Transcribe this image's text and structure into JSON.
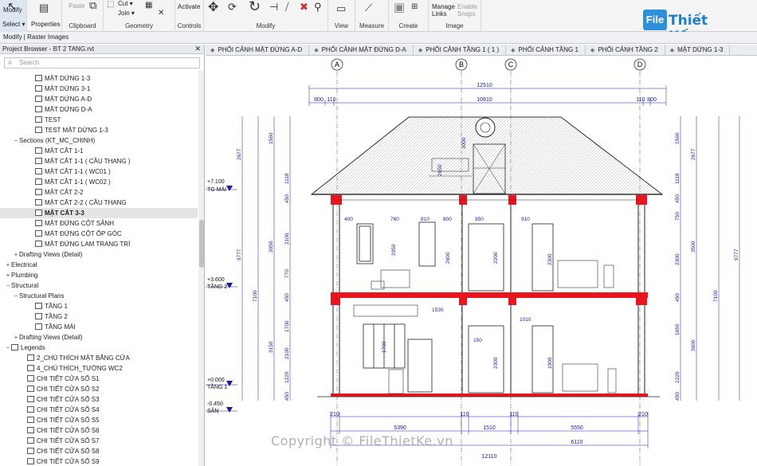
{
  "ribbon": {
    "modify_label": "Modify",
    "select_label": "Select ▾",
    "properties_label": "Properties",
    "paste_label": "Paste",
    "clipboard_label": "Clipboard",
    "cut_label": "Cut ▾",
    "join_label": "Join ▾",
    "geometry_label": "Geometry",
    "activate_label": "Activate",
    "controls_label": "Controls",
    "modify_group_label": "Modify",
    "view_label": "View",
    "measure_label": "Measure",
    "create_label": "Create",
    "manage_links_label": "Manage Links",
    "enable_snaps_label": "Enable Snaps",
    "image_label": "Image"
  },
  "options_bar": {
    "text": "Modify | Raster Images"
  },
  "project_browser": {
    "title": "Project Browser - BT 2 TANG.rvt",
    "search_placeholder": "Search",
    "items": [
      {
        "label": "MẶT DỨNG 1-3",
        "indent": 3,
        "type": "view",
        "toggle": ""
      },
      {
        "label": "MẶT DỨNG 3-1",
        "indent": 3,
        "type": "view",
        "toggle": ""
      },
      {
        "label": "MẶT DỨNG A-D",
        "indent": 3,
        "type": "view",
        "toggle": ""
      },
      {
        "label": "MẶT DỨNG D-A",
        "indent": 3,
        "type": "view",
        "toggle": ""
      },
      {
        "label": "TEST",
        "indent": 3,
        "type": "view",
        "toggle": ""
      },
      {
        "label": "TEST MẶT DỨNG 1-3",
        "indent": 3,
        "type": "view",
        "toggle": ""
      },
      {
        "label": "Sections (KT_MC_CHINH)",
        "indent": 1,
        "type": "group",
        "toggle": "−"
      },
      {
        "label": "MẶT CẮT 1-1",
        "indent": 3,
        "type": "view",
        "toggle": ""
      },
      {
        "label": "MẶT CẮT 1-1 ( CẦU THANG )",
        "indent": 3,
        "type": "view",
        "toggle": ""
      },
      {
        "label": "MẶT CẮT 1-1 ( WC01 )",
        "indent": 3,
        "type": "view",
        "toggle": ""
      },
      {
        "label": "MẶT CẮT 1-1 ( WC02 )",
        "indent": 3,
        "type": "view",
        "toggle": ""
      },
      {
        "label": "MẶT CẮT 2-2",
        "indent": 3,
        "type": "view",
        "toggle": ""
      },
      {
        "label": "MẶT CẮT 2-2 ( CẦU THANG",
        "indent": 3,
        "type": "view",
        "toggle": ""
      },
      {
        "label": "MẶT CẮT 3-3",
        "indent": 3,
        "type": "view",
        "toggle": "",
        "selected": true
      },
      {
        "label": "MẶT ĐỨNG CỘT SẢNH",
        "indent": 3,
        "type": "view",
        "toggle": ""
      },
      {
        "label": "MẶT ĐỨNG CỘT ỐP GÓC",
        "indent": 3,
        "type": "view",
        "toggle": ""
      },
      {
        "label": "MẶT ĐỨNG LAM TRANG TRÍ",
        "indent": 3,
        "type": "view",
        "toggle": ""
      },
      {
        "label": "Drafting Views (Detail)",
        "indent": 1,
        "type": "group",
        "toggle": "+"
      },
      {
        "label": "Electrical",
        "indent": 0,
        "type": "group",
        "toggle": "+"
      },
      {
        "label": "Plumbing",
        "indent": 0,
        "type": "group",
        "toggle": "+"
      },
      {
        "label": "Structural",
        "indent": 0,
        "type": "group",
        "toggle": "−"
      },
      {
        "label": "Structural Plans",
        "indent": 1,
        "type": "group",
        "toggle": "−"
      },
      {
        "label": "TẦNG 1",
        "indent": 3,
        "type": "view",
        "toggle": ""
      },
      {
        "label": "TẦNG 2",
        "indent": 3,
        "type": "view",
        "toggle": ""
      },
      {
        "label": "TẦNG MÁI",
        "indent": 3,
        "type": "view",
        "toggle": ""
      },
      {
        "label": "Drafting Views (Detail)",
        "indent": 1,
        "type": "group",
        "toggle": "+"
      },
      {
        "label": "Legends",
        "indent": 0,
        "type": "legendgroup",
        "toggle": "−"
      },
      {
        "label": "2_CHÚ THÍCH MẶT BẰNG CỬA",
        "indent": 2,
        "type": "view",
        "toggle": ""
      },
      {
        "label": "4_CHÚ THÍCH_TƯỜNG WC2",
        "indent": 2,
        "type": "view",
        "toggle": ""
      },
      {
        "label": "CHI TIẾT CỬA SỔ S1",
        "indent": 2,
        "type": "view",
        "toggle": ""
      },
      {
        "label": "CHI TIẾT CỬA SỔ S2",
        "indent": 2,
        "type": "view",
        "toggle": ""
      },
      {
        "label": "CHI TIẾT CỬA SỔ S3",
        "indent": 2,
        "type": "view",
        "toggle": ""
      },
      {
        "label": "CHI TIẾT CỬA SỔ S4",
        "indent": 2,
        "type": "view",
        "toggle": ""
      },
      {
        "label": "CHI TIẾT CỬA SỔ S5",
        "indent": 2,
        "type": "view",
        "toggle": ""
      },
      {
        "label": "CHI TIẾT CỬA SỔ S6",
        "indent": 2,
        "type": "view",
        "toggle": ""
      },
      {
        "label": "CHI TIẾT CỬA SỔ S7",
        "indent": 2,
        "type": "view",
        "toggle": ""
      },
      {
        "label": "CHI TIẾT CỬA SỔ S8",
        "indent": 2,
        "type": "view",
        "toggle": ""
      },
      {
        "label": "CHI TIẾT CỬA SỔ S9",
        "indent": 2,
        "type": "view",
        "toggle": ""
      }
    ]
  },
  "tabs": [
    {
      "label": "PHỐI CẢNH MẶT ĐỨNG A-D"
    },
    {
      "label": "PHỐI CẢNH MẶT ĐỨNG D-A"
    },
    {
      "label": "PHỐI CẢNH TẦNG 1 ( 1 )"
    },
    {
      "label": "PHỐI CẢNH TẦNG 1"
    },
    {
      "label": "PHỐI CẢNH TẦNG 2"
    },
    {
      "label": "MẶT DỨNG 1-3"
    }
  ],
  "drawing": {
    "grid_labels": [
      "A",
      "B",
      "C",
      "D"
    ],
    "top_dims": {
      "overall": "12510",
      "inner": "10910",
      "left_a": "800",
      "left_b": "110",
      "right_a": "110",
      "right_b": "800"
    },
    "bottom_dims": {
      "seg1": "210",
      "seg2": "5390",
      "seg3": "110",
      "seg4": "1510",
      "seg5": "110",
      "seg6": "5550",
      "seg7": "210",
      "total": "12110",
      "right_total": "6110"
    },
    "levels": [
      {
        "elev": "+7.100",
        "name": "TG MÁI"
      },
      {
        "elev": "+3.600",
        "name": "TẦNG 2"
      },
      {
        "elev": "+0.000",
        "name": "TẦNG 1"
      },
      {
        "elev": "-0.450",
        "name": "SÂN"
      }
    ],
    "vdims_left": [
      "2677",
      "1560",
      "1118",
      "450",
      "9777",
      "3050",
      "2100",
      "770",
      "450",
      "7100",
      "1700",
      "3150",
      "2100",
      "1220",
      "450"
    ],
    "vdims_right": [
      "1560",
      "2677",
      "1118",
      "450",
      "750",
      "3500",
      "2300",
      "9777",
      "450",
      "7100",
      "1650",
      "3600",
      "1220",
      "450"
    ],
    "room_dims": [
      "400",
      "760",
      "810",
      "800",
      "950",
      "910",
      "2050",
      "2200",
      "2300",
      "2600",
      "1530",
      "150",
      "1010",
      "1700",
      "2300",
      "1900",
      "3000",
      "2650"
    ]
  },
  "logo": {
    "box_text": "File",
    "text": "Thiết Kế.vn"
  },
  "watermark": {
    "text": "Copyright © FileThietKe.vn"
  },
  "colors": {
    "accent": "#2e90d8",
    "section_cut": "#e8141e",
    "dimension": "#1a1aa0"
  }
}
